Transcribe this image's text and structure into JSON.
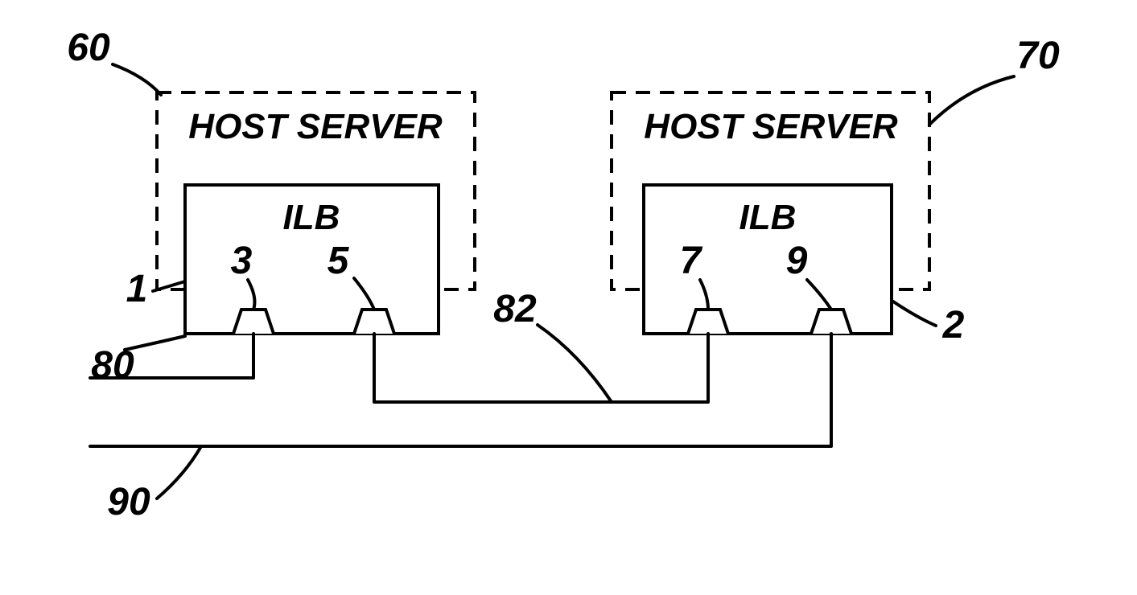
{
  "hostLeft": {
    "title": "HOST SERVER",
    "ilb": "ILB"
  },
  "hostRight": {
    "title": "HOST SERVER",
    "ilb": "ILB"
  },
  "labels": {
    "n60": "60",
    "n70": "70",
    "n1": "1",
    "n2": "2",
    "n3": "3",
    "n5": "5",
    "n7": "7",
    "n9": "9",
    "n80": "80",
    "n82": "82",
    "n90": "90"
  }
}
